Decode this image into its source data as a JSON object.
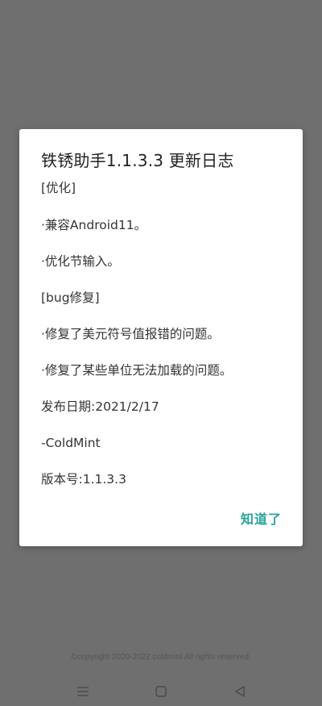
{
  "dialog": {
    "title": "铁锈助手1.1.3.3 更新日志",
    "lines": [
      "[优化]",
      "·兼容Android11。",
      "·优化节输入。",
      "[bug修复]",
      "·修复了美元符号值报错的问题。",
      "·修复了某些单位无法加载的问题。",
      "发布日期:2021/2/17",
      "-ColdMint",
      "版本号:1.1.3.3"
    ],
    "ok_label": "知道了"
  },
  "footer": {
    "copyright": "©copyright 2020-2022 coldmint All rights reserved."
  },
  "navbar": {
    "icons": [
      "menu-icon",
      "home-icon",
      "back-icon"
    ]
  },
  "colors": {
    "background_overlay": "#6f6f6f",
    "dialog_bg": "#ffffff",
    "accent": "#2aa39a"
  }
}
